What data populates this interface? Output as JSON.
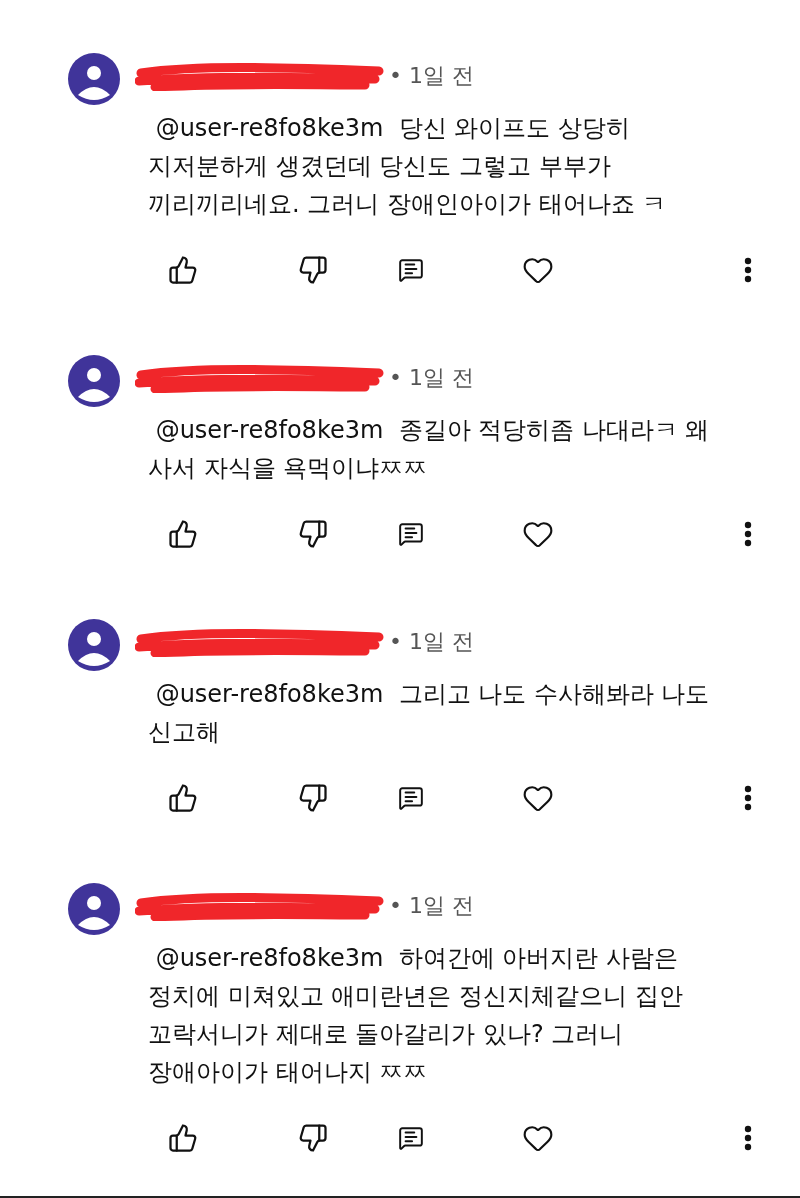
{
  "comments": [
    {
      "time": "• 1일 전",
      "text": " @user-re8fo8ke3m  당신 와이프도 상당히\n지저분하게 생겼던데 당신도 그렇고 부부가\n끼리끼리네요. 그러니 장애인아이가 태어나죠 ㅋ"
    },
    {
      "time": "• 1일 전",
      "text": " @user-re8fo8ke3m  종길아 적당히좀 나대라ㅋ 왜\n사서 자식을 욕먹이냐ㅉㅉ"
    },
    {
      "time": "• 1일 전",
      "text": " @user-re8fo8ke3m  그리고 나도 수사해봐라 나도\n신고해"
    },
    {
      "time": "• 1일 전",
      "text": " @user-re8fo8ke3m  하여간에 아버지란 사람은\n정치에 미쳐있고 애미란년은 정신지체같으니 집안\n꼬락서니가 제대로 돌아갈리가 있나? 그러니\n장애아이가 태어나지 ㅉㅉ"
    }
  ]
}
